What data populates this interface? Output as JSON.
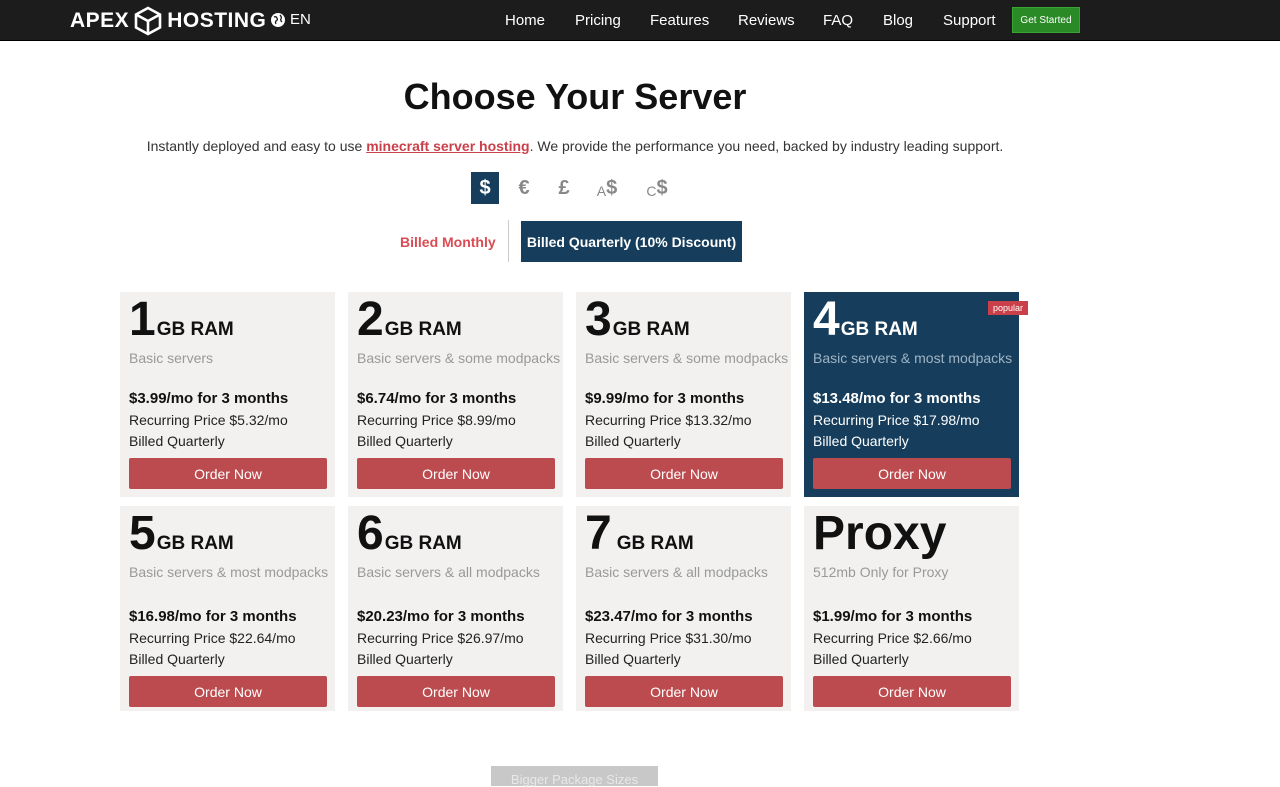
{
  "header": {
    "logo_left": "APEX",
    "logo_right": "HOSTING",
    "language": "EN",
    "nav": [
      "Home",
      "Pricing",
      "Features",
      "Reviews",
      "FAQ",
      "Blog",
      "Support"
    ],
    "cta": "Get Started"
  },
  "hero": {
    "title": "Choose Your Server",
    "subtitle_before": "Instantly deployed and easy to use ",
    "subtitle_link": "minecraft server hosting",
    "subtitle_after": ". We provide the performance you need, backed by industry leading support."
  },
  "currencies": [
    {
      "symbol": "$",
      "prefix": "",
      "active": true
    },
    {
      "symbol": "€",
      "prefix": "",
      "active": false
    },
    {
      "symbol": "£",
      "prefix": "",
      "active": false
    },
    {
      "symbol": "$",
      "prefix": "A",
      "active": false
    },
    {
      "symbol": "$",
      "prefix": "C",
      "active": false
    }
  ],
  "billing": {
    "monthly": "Billed Monthly",
    "quarterly": "Billed Quarterly (10% Discount)",
    "selected": "quarterly"
  },
  "plans": [
    {
      "size": "1",
      "unit": "GB RAM",
      "desc": "Basic servers",
      "price": "$3.99/mo for 3 months",
      "recurring": "Recurring Price $5.32/mo",
      "billed": "Billed Quarterly",
      "order": "Order Now"
    },
    {
      "size": "2",
      "unit": "GB RAM",
      "desc": "Basic servers & some modpacks",
      "price": "$6.74/mo for 3 months",
      "recurring": "Recurring Price $8.99/mo",
      "billed": "Billed Quarterly",
      "order": "Order Now"
    },
    {
      "size": "3",
      "unit": "GB RAM",
      "desc": "Basic servers & some modpacks",
      "price": "$9.99/mo for 3 months",
      "recurring": "Recurring Price $13.32/mo",
      "billed": "Billed Quarterly",
      "order": "Order Now"
    },
    {
      "size": "4",
      "unit": "GB RAM",
      "desc": "Basic servers & most modpacks",
      "price": "$13.48/mo for 3 months",
      "recurring": "Recurring Price $17.98/mo",
      "billed": "Billed Quarterly",
      "order": "Order Now",
      "badge": "popular"
    },
    {
      "size": "5",
      "unit": "GB RAM",
      "desc": "Basic servers & most modpacks",
      "price": "$16.98/mo for 3 months",
      "recurring": "Recurring Price $22.64/mo",
      "billed": "Billed Quarterly",
      "order": "Order Now"
    },
    {
      "size": "6",
      "unit": "GB RAM",
      "desc": "Basic servers & all modpacks",
      "price": "$20.23/mo for 3 months",
      "recurring": "Recurring Price $26.97/mo",
      "billed": "Billed Quarterly",
      "order": "Order Now"
    },
    {
      "size": "7",
      "unit": "GB RAM",
      "desc": "Basic servers & all modpacks",
      "price": "$23.47/mo for 3 months",
      "recurring": "Recurring Price $31.30/mo",
      "billed": "Billed Quarterly",
      "order": "Order Now"
    },
    {
      "size": "Proxy",
      "unit": "",
      "desc": "512mb Only for Proxy",
      "price": "$1.99/mo for 3 months",
      "recurring": "Recurring Price $2.66/mo",
      "billed": "Billed Quarterly",
      "order": "Order Now"
    }
  ],
  "footer_button": "Bigger Package Sizes",
  "colors": {
    "nav_bg": "#1c1c1c",
    "accent_navy": "#163e5c",
    "order_red": "#bb4b4e",
    "link_red": "#c9404a",
    "cta_green": "#2a8a26",
    "card_bg": "#f2f1f0"
  }
}
